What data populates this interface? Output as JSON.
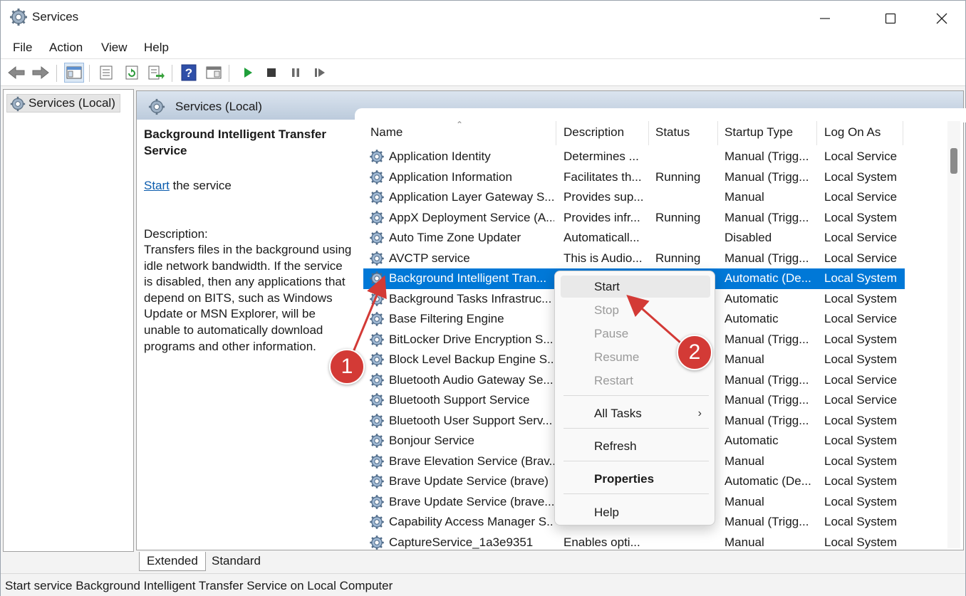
{
  "window": {
    "title": "Services",
    "minimize_glyph": "—",
    "maximize_glyph": "☐",
    "close_glyph": "✕"
  },
  "menu": [
    "File",
    "Action",
    "View",
    "Help"
  ],
  "toolbar_icons": [
    "back-arrow-icon",
    "forward-arrow-icon",
    "show-hide-console-tree-icon",
    "properties-icon",
    "refresh-icon",
    "export-list-icon",
    "help-icon",
    "action-pane-icon",
    "start-service-icon",
    "stop-service-icon",
    "pause-service-icon",
    "resume-service-icon"
  ],
  "tree": {
    "item": "Services (Local)"
  },
  "pane": {
    "title": "Services (Local)",
    "selected_service_title": "Background Intelligent Transfer Service",
    "start_link": "Start",
    "start_suffix": " the service",
    "description_label": "Description:",
    "description_text": "Transfers files in the background using idle network bandwidth. If the service is disabled, then any applications that depend on BITS, such as Windows Update or MSN Explorer, will be unable to automatically download programs and other information."
  },
  "columns": [
    "Name",
    "Description",
    "Status",
    "Startup Type",
    "Log On As"
  ],
  "services": [
    {
      "name": "Application Identity",
      "description": "Determines ...",
      "status": "",
      "startup": "Manual (Trigg...",
      "logon": "Local Service"
    },
    {
      "name": "Application Information",
      "description": "Facilitates th...",
      "status": "Running",
      "startup": "Manual (Trigg...",
      "logon": "Local System"
    },
    {
      "name": "Application Layer Gateway S...",
      "description": "Provides sup...",
      "status": "",
      "startup": "Manual",
      "logon": "Local Service"
    },
    {
      "name": "AppX Deployment Service (A...",
      "description": "Provides infr...",
      "status": "Running",
      "startup": "Manual (Trigg...",
      "logon": "Local System"
    },
    {
      "name": "Auto Time Zone Updater",
      "description": "Automaticall...",
      "status": "",
      "startup": "Disabled",
      "logon": "Local Service"
    },
    {
      "name": "AVCTP service",
      "description": "This is Audio...",
      "status": "Running",
      "startup": "Manual (Trigg...",
      "logon": "Local Service"
    },
    {
      "name": "Background Intelligent Tran...",
      "description": "",
      "status": "",
      "startup": "Automatic (De...",
      "logon": "Local System",
      "selected": true
    },
    {
      "name": "Background Tasks Infrastruc...",
      "description": "",
      "status": "",
      "startup": "Automatic",
      "logon": "Local System"
    },
    {
      "name": "Base Filtering Engine",
      "description": "",
      "status": "",
      "startup": "Automatic",
      "logon": "Local Service"
    },
    {
      "name": "BitLocker Drive Encryption S...",
      "description": "",
      "status": "",
      "startup": "Manual (Trigg...",
      "logon": "Local System"
    },
    {
      "name": "Block Level Backup Engine S...",
      "description": "",
      "status": "",
      "startup": "Manual",
      "logon": "Local System"
    },
    {
      "name": "Bluetooth Audio Gateway Se...",
      "description": "",
      "status": "",
      "startup": "Manual (Trigg...",
      "logon": "Local Service"
    },
    {
      "name": "Bluetooth Support Service",
      "description": "",
      "status": "",
      "startup": "Manual (Trigg...",
      "logon": "Local Service"
    },
    {
      "name": "Bluetooth User Support Serv...",
      "description": "",
      "status": "",
      "startup": "Manual (Trigg...",
      "logon": "Local System"
    },
    {
      "name": "Bonjour Service",
      "description": "",
      "status": "",
      "startup": "Automatic",
      "logon": "Local System"
    },
    {
      "name": "Brave Elevation Service (Brav...",
      "description": "",
      "status": "",
      "startup": "Manual",
      "logon": "Local System"
    },
    {
      "name": "Brave Update Service (brave)",
      "description": "",
      "status": "",
      "startup": "Automatic (De...",
      "logon": "Local System"
    },
    {
      "name": "Brave Update Service (brave...",
      "description": "",
      "status": "",
      "startup": "Manual",
      "logon": "Local System"
    },
    {
      "name": "Capability Access Manager S...",
      "description": "",
      "status": "",
      "startup": "Manual (Trigg...",
      "logon": "Local System"
    },
    {
      "name": "CaptureService_1a3e9351",
      "description": "Enables opti...",
      "status": "",
      "startup": "Manual",
      "logon": "Local System"
    }
  ],
  "context_menu": {
    "start": "Start",
    "stop": "Stop",
    "pause": "Pause",
    "resume": "Resume",
    "restart": "Restart",
    "all_tasks": "All Tasks",
    "all_tasks_arrow": "›",
    "refresh": "Refresh",
    "properties": "Properties",
    "help": "Help"
  },
  "tabs": [
    "Extended",
    "Standard"
  ],
  "status_bar": "Start service Background Intelligent Transfer Service on Local Computer",
  "annotations": {
    "badge1": "1",
    "badge2": "2",
    "color": "#d33a36"
  },
  "colors": {
    "selection": "#0078d7",
    "link": "#0b5cad",
    "header_gradient_top": "#dbe4ef",
    "header_gradient_bottom": "#bccbdc"
  }
}
